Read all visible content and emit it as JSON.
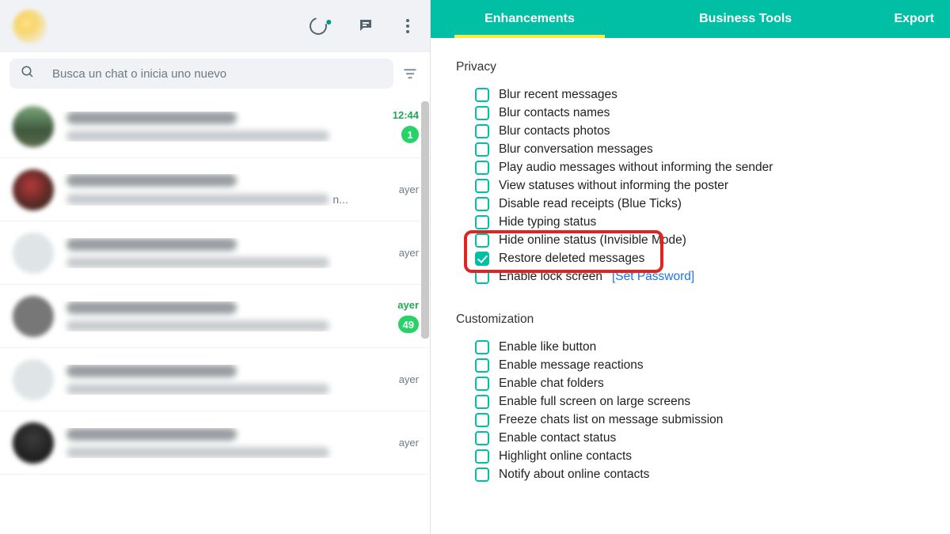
{
  "search": {
    "placeholder": "Busca un chat o inicia uno nuevo"
  },
  "chats": [
    {
      "time": "12:44",
      "time_class": "time-green",
      "badge": "1",
      "avatar": "av1",
      "trail": ""
    },
    {
      "time": "ayer",
      "time_class": "time-grey",
      "badge": "",
      "avatar": "av2",
      "trail": "n..."
    },
    {
      "time": "ayer",
      "time_class": "time-grey",
      "badge": "",
      "avatar": "av3",
      "trail": ""
    },
    {
      "time": "ayer",
      "time_class": "time-green",
      "badge": "49",
      "avatar": "av4",
      "trail": ""
    },
    {
      "time": "ayer",
      "time_class": "time-grey",
      "badge": "",
      "avatar": "av5",
      "trail": ""
    },
    {
      "time": "ayer",
      "time_class": "time-grey",
      "badge": "",
      "avatar": "av6",
      "trail": ""
    }
  ],
  "tabs": {
    "t1": "Enhancements",
    "t2": "Business Tools",
    "t3": "Export"
  },
  "sections": {
    "privacy": {
      "title": "Privacy",
      "opts": [
        {
          "label": "Blur recent messages",
          "checked": false
        },
        {
          "label": "Blur contacts names",
          "checked": false
        },
        {
          "label": "Blur contacts photos",
          "checked": false
        },
        {
          "label": "Blur conversation messages",
          "checked": false
        },
        {
          "label": "Play audio messages without informing the sender",
          "checked": false
        },
        {
          "label": "View statuses without informing the poster",
          "checked": false
        },
        {
          "label": "Disable read receipts (Blue Ticks)",
          "checked": false
        },
        {
          "label": "Hide typing status",
          "checked": false
        },
        {
          "label": "Hide online status (Invisible Mode)",
          "checked": false
        },
        {
          "label": "Restore deleted messages",
          "checked": true,
          "highlight": true
        },
        {
          "label": "Enable lock screen ",
          "checked": false,
          "link": "[Set Password]"
        }
      ]
    },
    "customization": {
      "title": "Customization",
      "opts": [
        {
          "label": "Enable like button",
          "checked": false
        },
        {
          "label": "Enable message reactions",
          "checked": false
        },
        {
          "label": "Enable chat folders",
          "checked": false
        },
        {
          "label": "Enable full screen on large screens",
          "checked": false
        },
        {
          "label": "Freeze chats list on message submission",
          "checked": false
        },
        {
          "label": "Enable contact status",
          "checked": false
        },
        {
          "label": "Highlight online contacts",
          "checked": false
        },
        {
          "label": "Notify about online contacts",
          "checked": false
        }
      ]
    }
  }
}
